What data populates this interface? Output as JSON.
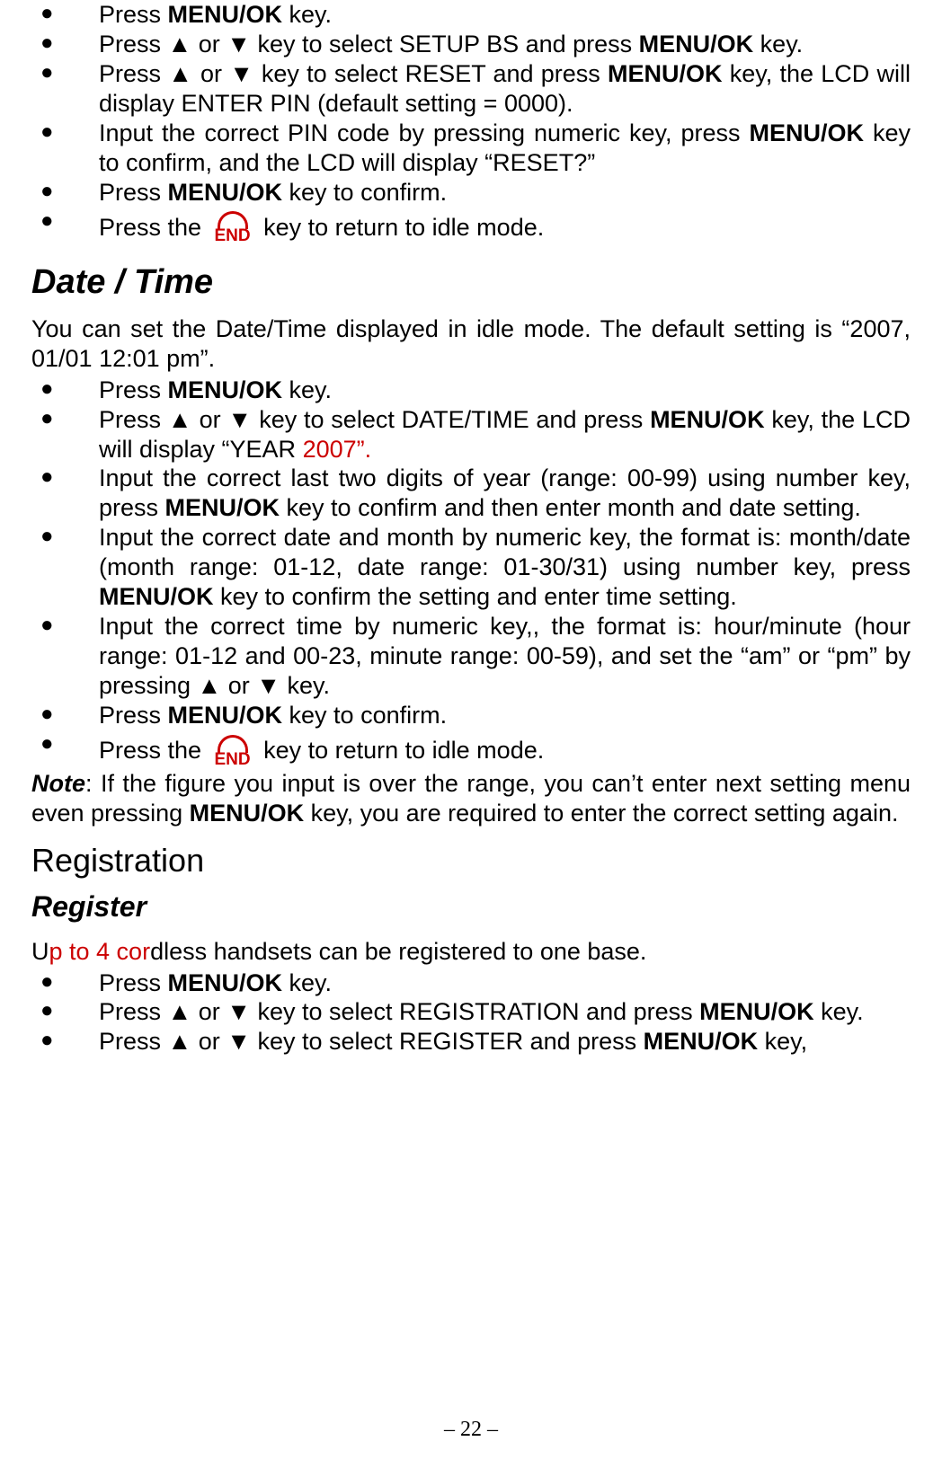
{
  "list1": {
    "i0": {
      "a": "Press ",
      "b1": "MENU/OK",
      "c": " key."
    },
    "i1": {
      "a": "Press ▲ or ▼ key to select SETUP BS and press ",
      "b1": "MENU/OK",
      "c": " key."
    },
    "i2": {
      "a": "Press ▲ or ▼ key to select RESET and press ",
      "b1": "MENU/OK",
      "c": " key, the LCD will display ENTER PIN (default setting = 0000)."
    },
    "i3": {
      "a": "Input the correct PIN code by pressing numeric key, press ",
      "b1": "MENU/OK",
      "c": " key to confirm, and the LCD will display “RESET?”"
    },
    "i4": {
      "a": "Press ",
      "b1": "MENU/OK",
      "c": " key to confirm."
    },
    "i5": {
      "a": "Press the ",
      "end": "END",
      "c": " key to return to idle mode."
    }
  },
  "h_date": "Date / Time",
  "date_intro": "You can set the Date/Time displayed in idle mode. The default setting is “2007, 01/01 12:01 pm”.",
  "list2": {
    "i0": {
      "a": "Press ",
      "b1": "MENU/OK",
      "c": " key."
    },
    "i1": {
      "a": "Press ▲ or ▼ key to select DATE/TIME and press ",
      "b1": "MENU/OK",
      "c": " key, the LCD will display “YEAR ",
      "r": "2007”.",
      "d": ""
    },
    "i2": {
      "a": "Input the correct last two digits of year (range: 00-99) using number key, press ",
      "b1": "MENU/OK",
      "c": " key to confirm and then enter month and date setting."
    },
    "i3": {
      "a": "Input the correct date and month by numeric key, the format is: month/date (month range: 01-12, date range: 01-30/31) using number key, press ",
      "b1": "MENU/OK",
      "c": " key to confirm the setting and enter time setting."
    },
    "i4": {
      "a": "Input the correct time by numeric key,, the format is: hour/minute (hour range: 01-12 and 00-23, minute range: 00-59), and set the “am” or “pm” by pressing ▲ or ▼ key."
    },
    "i5": {
      "a": "Press ",
      "b1": "MENU/OK",
      "c": " key to confirm."
    },
    "i6": {
      "a": "Press the ",
      "end": "END",
      "c": " key to return to idle mode."
    }
  },
  "note": {
    "label": "Note",
    "a": ": If the figure you input is over the range, you can’t enter next setting menu even pressing ",
    "b1": "MENU/OK",
    "c": " key, you are required to   enter the correct setting again."
  },
  "h_reg": "Registration",
  "h_register": "Register",
  "reg_intro": {
    "a": "U",
    "r": "p to 4 cor",
    "c": "dless handsets can be registered to one base."
  },
  "list3": {
    "i0": {
      "a": "Press ",
      "b1": "MENU/OK",
      "c": " key."
    },
    "i1": {
      "a": "Press ▲ or ▼ key to select REGISTRATION and press ",
      "b1": "MENU/OK",
      "c": " key."
    },
    "i2": {
      "a": "Press ▲ or ▼ key to select REGISTER and press ",
      "b1": "MENU/OK",
      "c": " key,"
    }
  },
  "page_num": "– 22 –"
}
